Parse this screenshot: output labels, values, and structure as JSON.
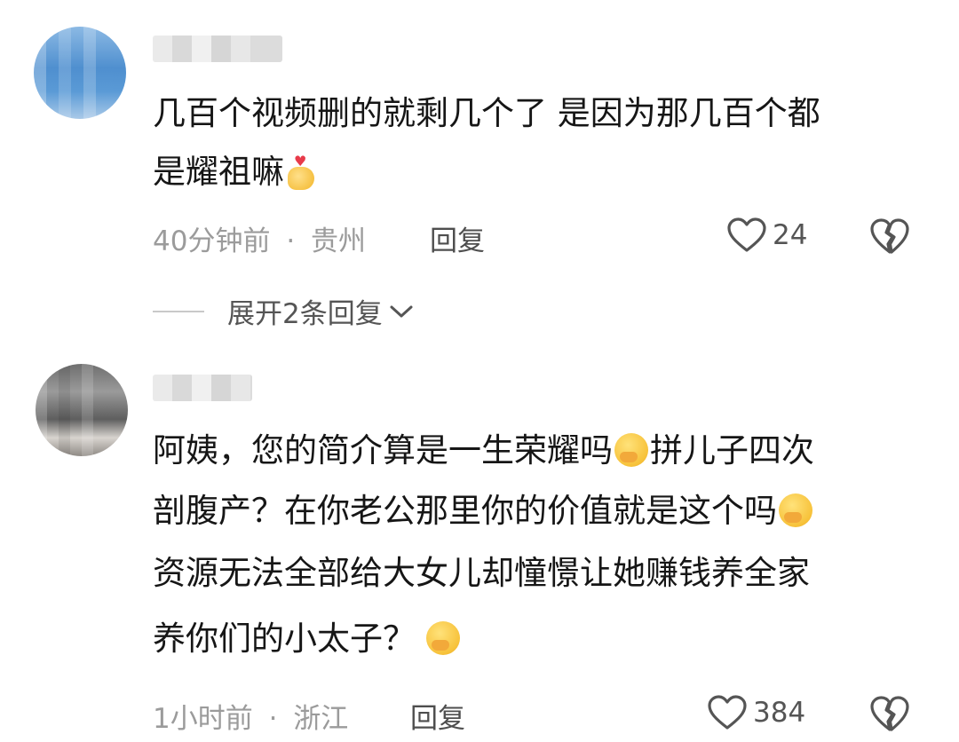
{
  "comments": [
    {
      "text_line1": "几百个视频删的就剩几个了 是因为那几百个都",
      "text_line2": "是耀祖嘛",
      "time": "40分钟前",
      "dot": "·",
      "location": "贵州",
      "reply_label": "回复",
      "likes": "24",
      "expand_label": "展开2条回复"
    },
    {
      "text_line1": "阿姨，您的简介算是一生荣耀吗",
      "text_line1b": "拼儿子四次",
      "text_line2": "剖腹产？在你老公那里你的价值就是这个吗",
      "text_line3": "资源无法全部给大女儿却憧憬让她赚钱养全家",
      "text_line4": "养你们的小太子？",
      "time": "1小时前",
      "dot": "·",
      "location": "浙江",
      "reply_label": "回复",
      "likes": "384"
    }
  ],
  "icons": {
    "like": "heart-outline-icon",
    "dislike": "broken-heart-icon",
    "expand": "chevron-down-icon",
    "emoji_heart_hand": "heart-hands-emoji",
    "emoji_face": "hand-over-mouth-emoji"
  }
}
